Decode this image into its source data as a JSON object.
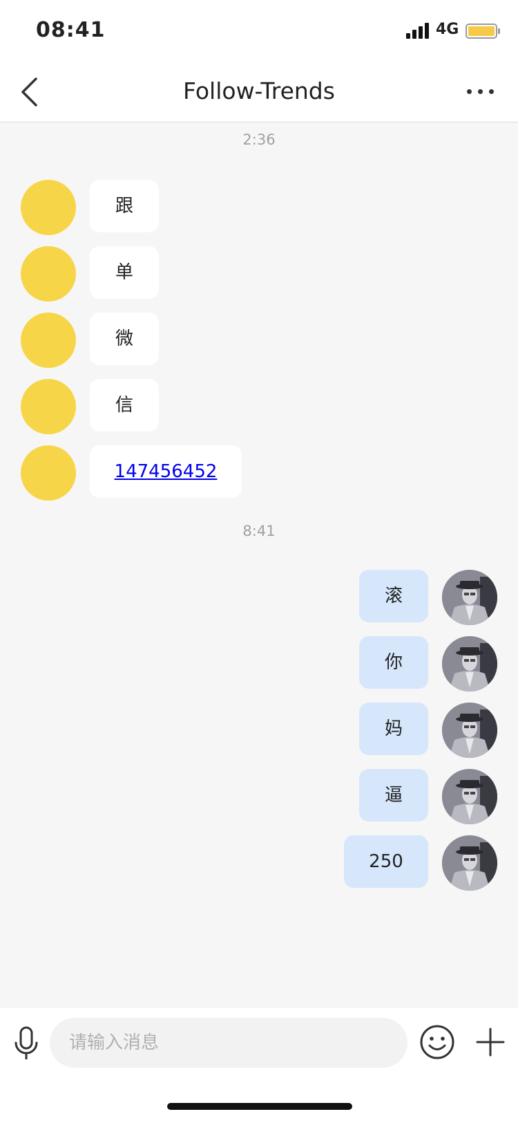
{
  "status_bar": {
    "time": "08:41",
    "network": "4G",
    "battery_fill_color": "#f7c948"
  },
  "nav": {
    "title": "Follow-Trends",
    "back_icon": "chevron-left-icon",
    "more_icon": "more-horizontal-icon"
  },
  "conversation": {
    "timestamps": [
      "2:36",
      "8:41"
    ],
    "incoming": [
      {
        "text": "跟"
      },
      {
        "text": "单"
      },
      {
        "text": "微"
      },
      {
        "text": "信"
      },
      {
        "text": "147456452",
        "is_link": true
      }
    ],
    "outgoing": [
      {
        "text": "滚"
      },
      {
        "text": "你"
      },
      {
        "text": "妈"
      },
      {
        "text": "逼"
      },
      {
        "text": "250"
      }
    ],
    "incoming_avatar_color": "#f7d548",
    "outgoing_bubble_color": "#d6e6fb"
  },
  "input_bar": {
    "placeholder": "请输入消息",
    "value": "",
    "mic_icon": "microphone-icon",
    "emoji_icon": "smile-icon",
    "plus_icon": "plus-icon"
  }
}
